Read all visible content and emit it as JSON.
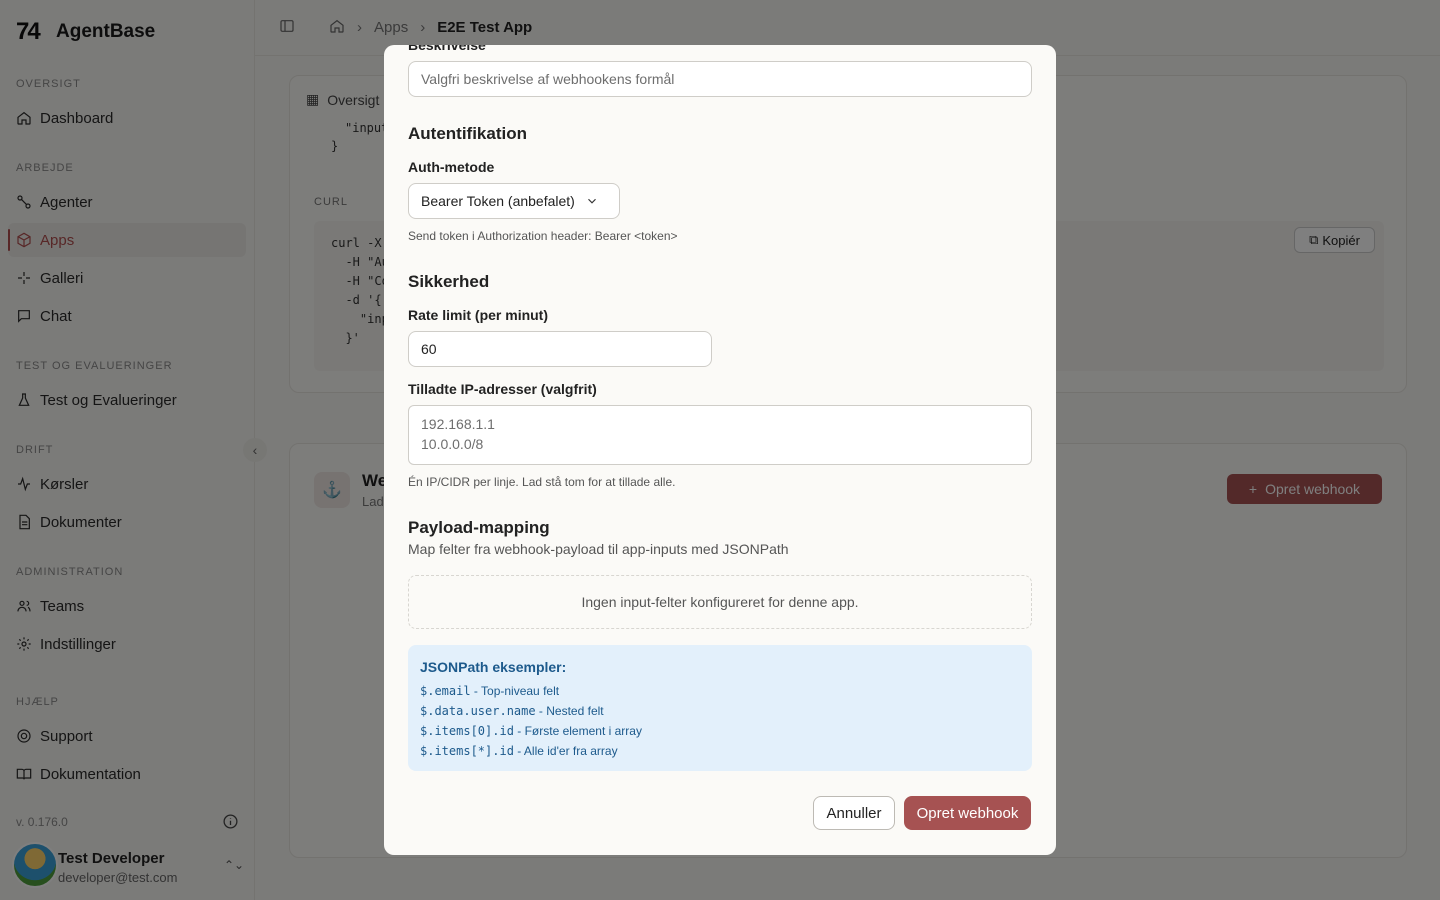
{
  "app": {
    "name": "AgentBase",
    "logo_text": "74"
  },
  "sidebar": {
    "sections": [
      {
        "title": "OVERSIGT",
        "items": [
          {
            "label": "Dashboard",
            "icon": "home-icon"
          }
        ]
      },
      {
        "title": "ARBEJDE",
        "items": [
          {
            "label": "Agenter",
            "icon": "agent-icon"
          },
          {
            "label": "Apps",
            "icon": "box-icon",
            "active": true
          },
          {
            "label": "Galleri",
            "icon": "sparkle-icon"
          },
          {
            "label": "Chat",
            "icon": "chat-icon"
          }
        ]
      },
      {
        "title": "TEST OG EVALUERINGER",
        "items": [
          {
            "label": "Test og Evalueringer",
            "icon": "flask-icon"
          }
        ]
      },
      {
        "title": "DRIFT",
        "items": [
          {
            "label": "Kørsler",
            "icon": "activity-icon"
          },
          {
            "label": "Dokumenter",
            "icon": "document-icon"
          }
        ]
      },
      {
        "title": "ADMINISTRATION",
        "items": [
          {
            "label": "Teams",
            "icon": "users-icon"
          },
          {
            "label": "Indstillinger",
            "icon": "gear-icon"
          }
        ]
      },
      {
        "title": "HJÆLP",
        "items": [
          {
            "label": "Support",
            "icon": "lifebuoy-icon"
          },
          {
            "label": "Dokumentation",
            "icon": "book-icon"
          }
        ]
      }
    ],
    "version": "v. 0.176.0",
    "user": {
      "name": "Test Developer",
      "email": "developer@test.com"
    }
  },
  "breadcrumb": {
    "items": [
      "Apps"
    ],
    "current": "E2E Test App"
  },
  "background": {
    "tab_label": "Oversigt",
    "code_top": [
      "\"input",
      "}"
    ],
    "curl_label": "CURL",
    "curl_lines": [
      "curl -X",
      "  -H \"Au",
      "  -H \"Co",
      "  -d '{",
      "    \"inp",
      "  }'"
    ],
    "copy_label": "Kopiér",
    "webhook_title": "We",
    "webhook_sub": "Lad",
    "create_webhook_label": "Opret webhook"
  },
  "modal": {
    "description_label": "Beskrivelse",
    "description_placeholder": "Valgfri beskrivelse af webhookens formål",
    "auth_heading": "Autentifikation",
    "auth_method_label": "Auth-metode",
    "auth_method_value": "Bearer Token (anbefalet)",
    "auth_help": "Send token i Authorization header: Bearer <token>",
    "security_heading": "Sikkerhed",
    "rate_limit_label": "Rate limit (per minut)",
    "rate_limit_value": "60",
    "ip_label": "Tilladte IP-adresser (valgfrit)",
    "ip_placeholder_lines": [
      "192.168.1.1",
      "10.0.0.0/8"
    ],
    "ip_help": "Én IP/CIDR per linje. Lad stå tom for at tillade alle.",
    "payload_heading": "Payload-mapping",
    "payload_sub": "Map felter fra webhook-payload til app-inputs med JSONPath",
    "empty_text": "Ingen input-felter konfigureret for denne app.",
    "examples_title": "JSONPath eksempler:",
    "examples": [
      {
        "code": "$.email",
        "desc": " - Top-niveau felt"
      },
      {
        "code": "$.data.user.name",
        "desc": " - Nested felt"
      },
      {
        "code": "$.items[0].id",
        "desc": " - Første element i array"
      },
      {
        "code": "$.items[*].id",
        "desc": " - Alle id'er fra array"
      }
    ],
    "cancel_label": "Annuller",
    "submit_label": "Opret webhook"
  }
}
